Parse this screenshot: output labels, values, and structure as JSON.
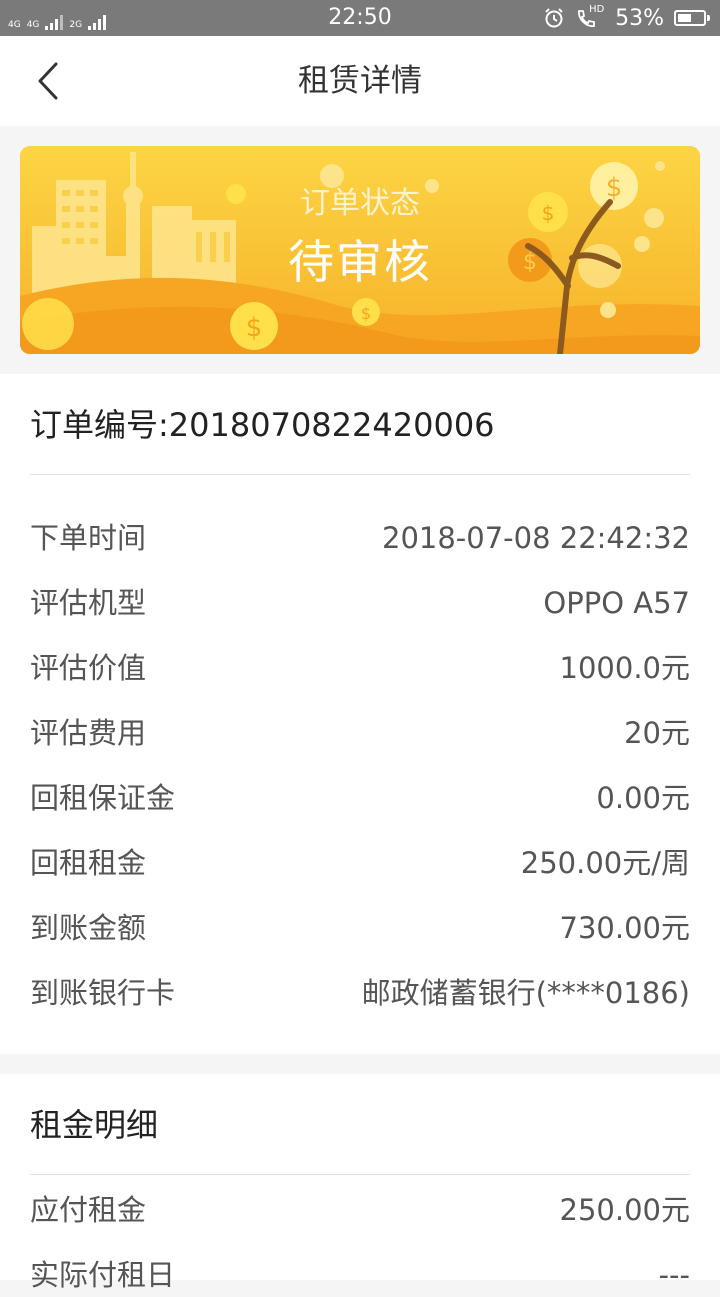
{
  "status_bar": {
    "net1": "4G",
    "net2": "4G",
    "net3": "2G",
    "time": "22:50",
    "battery_text": "53%",
    "battery_level": 0.53,
    "hd_label": "HD"
  },
  "nav": {
    "title": "租赁详情"
  },
  "banner": {
    "status_label": "订单状态",
    "status_value": "待审核",
    "colors": {
      "top": "#fcd544",
      "bottom": "#f7a21c",
      "hill": "#f39a1d",
      "coin": "#ffe04a"
    }
  },
  "order": {
    "number_text": "订单编号:2018070822420006",
    "rows": [
      {
        "key": "下单时间",
        "value": "2018-07-08 22:42:32"
      },
      {
        "key": "评估机型",
        "value": "OPPO A57"
      },
      {
        "key": "评估价值",
        "value": "1000.0元"
      },
      {
        "key": "评估费用",
        "value": "20元"
      },
      {
        "key": "回租保证金",
        "value": "0.00元"
      },
      {
        "key": "回租租金",
        "value": "250.00元/周"
      },
      {
        "key": "到账金额",
        "value": "730.00元"
      },
      {
        "key": "到账银行卡",
        "value": "邮政储蓄银行(****0186)"
      }
    ]
  },
  "rent_detail": {
    "title": "租金明细",
    "rows": [
      {
        "key": "应付租金",
        "value": "250.00元"
      },
      {
        "key": "实际付租日",
        "value": "---"
      }
    ]
  }
}
